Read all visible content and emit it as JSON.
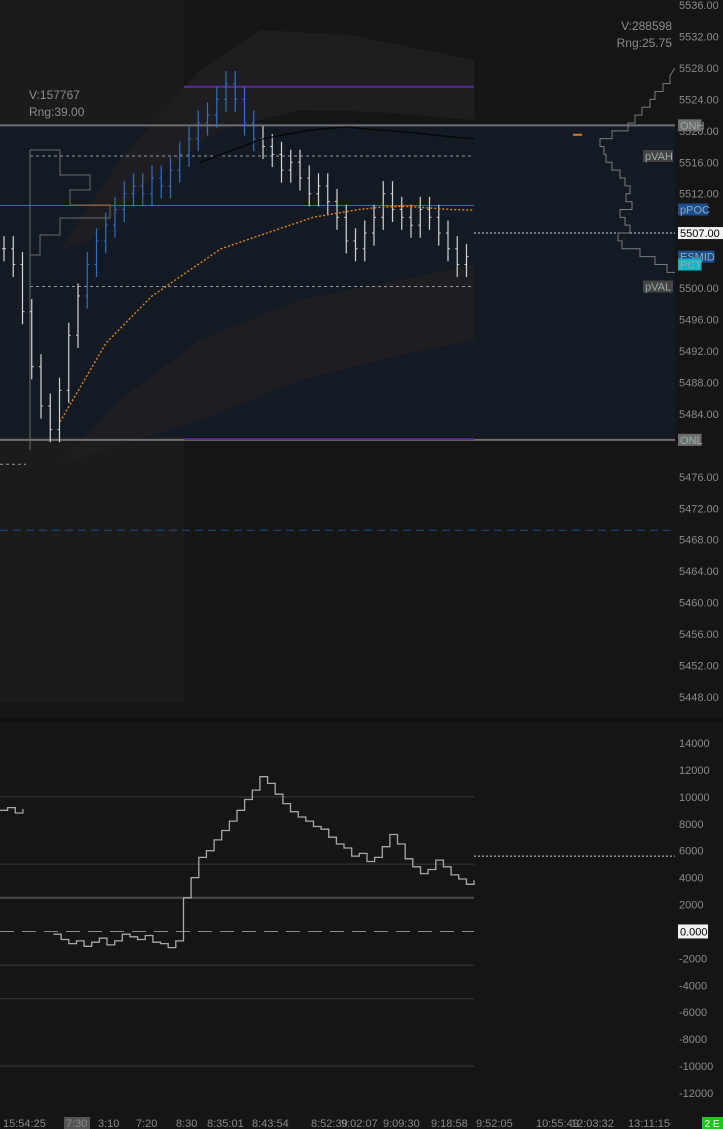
{
  "chart_data": [
    {
      "type": "candlestick",
      "ylim": [
        5444,
        5536
      ],
      "y_ticks": [
        5536,
        5532,
        5528,
        5524,
        5520,
        5516,
        5512,
        5508,
        5504,
        5500,
        5496,
        5492,
        5488,
        5484,
        5480,
        5476,
        5472,
        5468,
        5464,
        5460,
        5456,
        5452,
        5448
      ],
      "y_tick_labels": [
        "5536.00",
        "5532.00",
        "5528.00",
        "5524.00",
        "5520.00",
        "5516.00",
        "5512.00",
        "",
        "",
        "5500.00",
        "5496.00",
        "5492.00",
        "5488.00",
        "5484.00",
        "",
        "5476.00",
        "5472.00",
        "5468.00",
        "5464.00",
        "5460.00",
        "5456.00",
        "5452.00",
        "5448.00"
      ],
      "price_levels": [
        {
          "label": "ONH",
          "value": 5520.7,
          "color": "#6e6e6e"
        },
        {
          "label": "pVAH",
          "value": 5516.8,
          "color": "#444444"
        },
        {
          "label": "pPOC",
          "value": 5510.0,
          "color": "#1a4d8f"
        },
        {
          "label": "5507.00",
          "value": 5507.0,
          "color": "#ffffff"
        },
        {
          "label": "ESMID",
          "value": 5504.0,
          "color": "#1a4d8f"
        },
        {
          "label": "PCT",
          "value": 5503.0,
          "color": "#0fb8c8"
        },
        {
          "label": "pVAL",
          "value": 5500.2,
          "color": "#444444"
        },
        {
          "label": "ONL",
          "value": 5480.7,
          "color": "#6e6e6e"
        }
      ],
      "session_left": {
        "volume": "V:157767",
        "range": "Rng:39.00",
        "high": 5520.7,
        "low": 5480.7
      },
      "session_right": {
        "volume": "V:288598",
        "range": "Rng:25.75"
      },
      "purple_high": 5525.6,
      "purple_low": 5480.8,
      "blue_dashed_level": 5469.2,
      "closes": [
        5505,
        5503,
        5497,
        5490,
        5485,
        5482,
        5487,
        5494,
        5499,
        5503,
        5506,
        5508,
        5510,
        5512,
        5513,
        5512,
        5514,
        5513,
        5515,
        5517,
        5519,
        5521,
        5522,
        5524,
        5526,
        5524,
        5521,
        5519,
        5518,
        5517,
        5515,
        5516,
        5514,
        5512,
        5513,
        5511,
        5509,
        5506,
        5505,
        5507,
        5509,
        5512,
        5510,
        5509,
        5508,
        5510,
        5509,
        5507,
        5505,
        5503,
        5504
      ],
      "ma_orange": [
        5483,
        5488,
        5493,
        5496,
        5499,
        5501,
        5503,
        5505,
        5506,
        5507,
        5508,
        5509,
        5509.5,
        5510,
        5510.3,
        5510.4,
        5510.2,
        5510,
        5509.9
      ],
      "ma_black": [
        5516,
        5517,
        5518,
        5519,
        5519.5,
        5520,
        5520.3,
        5520.5,
        5520.2,
        5520,
        5519.8,
        5519.5,
        5519.2,
        5519
      ],
      "x_tick_labels": [
        "15:54:25",
        "7:30",
        "3:10",
        "7:20",
        "8:30",
        "8:35:01",
        "8:43:54",
        "8:52:39",
        "9:02:07",
        "9:09:30",
        "9:18:58",
        "9:52:05",
        "10:55:49",
        "12:03:32",
        "13:11:15"
      ]
    },
    {
      "type": "line",
      "ylim": [
        -13000,
        15000
      ],
      "y_ticks": [
        14000,
        12000,
        10000,
        8000,
        6000,
        4000,
        2000,
        0,
        -2000,
        -4000,
        -6000,
        -8000,
        -10000,
        -12000
      ],
      "y_tick_labels": [
        "14000",
        "12000",
        "10000",
        "8000",
        "6000",
        "4000",
        "2000",
        "0.000",
        "-2000",
        "-4000",
        "-6000",
        "-8000",
        "-10000",
        "-12000"
      ],
      "zero_label": "0.000",
      "values": [
        9000,
        9200,
        8800,
        9100,
        null,
        null,
        null,
        -200,
        -600,
        -900,
        -700,
        -1100,
        -800,
        -500,
        -1000,
        -700,
        -200,
        -400,
        -600,
        -300,
        -800,
        -900,
        -1200,
        -700,
        2500,
        4000,
        5500,
        6000,
        6800,
        7500,
        8200,
        9000,
        9800,
        10500,
        11500,
        11000,
        10200,
        9500,
        8900,
        8500,
        8200,
        7800,
        7600,
        7000,
        6500,
        6200,
        5600,
        5800,
        5200,
        5500,
        6300,
        7200,
        6500,
        5400,
        4800,
        4300,
        4600,
        5300,
        4800,
        4200,
        3900,
        3500,
        3800
      ],
      "ref_levels": [
        10000,
        5000,
        2500,
        0,
        -2500,
        -5000,
        -10000
      ],
      "dashed_right": 5600
    }
  ],
  "status": {
    "badge": "2 E"
  }
}
